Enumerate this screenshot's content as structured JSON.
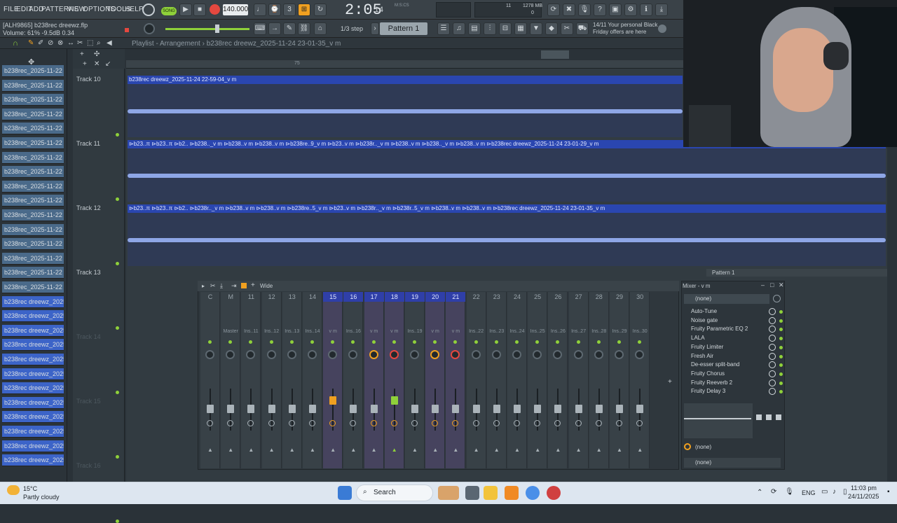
{
  "menu": [
    "FILE",
    "EDIT",
    "ADD",
    "PATTERNS",
    "VIEW",
    "OPTIONS",
    "TOOLS",
    "HELP"
  ],
  "song_badge": "SONG",
  "tempo": "140.000",
  "time": "2:05",
  "time_ms": "14",
  "time_sub": "M:S:CS",
  "cpu_mem": "1278 MB",
  "cpu_voices": "11",
  "cpu_zero": "0",
  "hint": {
    "line1": "[ALH9865] b238rec dreewz.flp",
    "line2": "Volume: 61%  -9.5dB  0.34"
  },
  "snap": "1/3 step",
  "pattern": "Pattern 1",
  "news": {
    "line1": "14/11  Your personal Black",
    "line2": "Friday offers are here"
  },
  "breadcrumb": "Playlist - Arrangement  ›  b238rec dreewz_2025-11-24 23-01-35_v m",
  "ruler_mark": "75",
  "browser": {
    "items": [
      "b238rec_2025-11-22 05-",
      "b238rec_2025-11-22 05-...",
      "b238rec_2025-11-22 05-...",
      "b238rec_2025-11-22 05-...",
      "b238rec_2025-11-22 05-...",
      "b238rec_2025-11-22 05-...",
      "b238rec_2025-11-22 06-...",
      "b238rec_2025-11-22 06-...",
      "b238rec_2025-11-22 06-...",
      "b238rec_2025-11-22 06-...",
      "b238rec_2025-11-22 06-...",
      "b238rec_2025-11-22 06-...",
      "b238rec_2025-11-22 06-...",
      "b238rec_2025-11-22 06-...",
      "b238rec_2025-11-22 06-...",
      "b238rec_2025-11-22 06-...",
      "b238rec dreewz_2025-11...",
      "b238rec dreewz_2025-11...",
      "b238rec dreewz_2025-11...",
      "b238rec dreewz_2025-11...",
      "b238rec dreewz_2025-11...",
      "b238rec dreewz_2025-11...",
      "b238rec dreewz_2025-11...",
      "b238rec dreewz_2025-11...",
      "b238rec dreewz_2025-11...",
      "b238rec dreewz_2025-11...",
      "b238rec dreewz_2025-11...",
      "b238rec dreewz_2025-11..."
    ]
  },
  "tracks": [
    {
      "label": "Track 10",
      "clip": "b238rec dreewz_2025-11-24 22-59-04_v m"
    },
    {
      "label": "Track 11",
      "clip": "⊳b23..π ⊳b23..π ⊳b2..  ⊳b238.._v m ⊳b238..v m ⊳b238..v m ⊳b238re..9_v m ⊳b23..v m ⊳b238r.._v m ⊳b238..v m ⊳b238.._v m ⊳b238..v m ⊳b238rec dreewz_2025-11-24 23-01-29_v m"
    },
    {
      "label": "Track 12",
      "clip": "⊳b23..π ⊳b23..π ⊳b2..  ⊳b238r.._v m ⊳b238..v m ⊳b238..v m ⊳b238re..5_v m ⊳b23..v m ⊳b238r.._v m ⊳b238r..5_v m ⊳b238..v m ⊳b238..v m ⊳b238rec dreewz_2025-11-24 23-01-35_v m"
    },
    {
      "label": "Track 13"
    },
    {
      "label": "Track 14"
    },
    {
      "label": "Track 15"
    },
    {
      "label": "Track 16"
    }
  ],
  "pattern_tag": "Pattern 1",
  "mixer": {
    "view": "Wide",
    "title": "Mixer - v m",
    "channels": [
      "C",
      "M",
      "11",
      "12",
      "13",
      "14",
      "15",
      "16",
      "17",
      "18",
      "19",
      "20",
      "21",
      "22",
      "23",
      "24",
      "25",
      "26",
      "27",
      "28",
      "29",
      "30"
    ],
    "names": [
      "",
      "Master",
      "Ins..11",
      "Ins..12",
      "Ins..13",
      "Ins..14",
      "v m",
      "Ins..16",
      "v m",
      "v m",
      "Ins..19",
      "v m",
      "v m",
      "Ins..22",
      "Ins..23",
      "Ins..24",
      "Ins..25",
      "Ins..26",
      "Ins..27",
      "Ins..28",
      "Ins..29",
      "Ins..30"
    ],
    "input": "(none)",
    "slots": [
      "Auto-Tune",
      "Noise gate",
      "Fruity Parametric EQ 2",
      "LALA",
      "Fruity Limiter",
      "Fresh Air",
      "De-esser split-band",
      "Fruity Chorus",
      "Fruity Reeverb 2",
      "Fruity Delay 3"
    ],
    "send1": "(none)",
    "send2": "(none)"
  },
  "taskbar": {
    "temp": "15°C",
    "weather": "Partly cloudy",
    "search": "Search",
    "lang": "ENG",
    "time": "11:03 pm",
    "date": "24/11/2025"
  },
  "colors": {
    "accent": "#f0a020",
    "clip": "#2a46b0",
    "selected_channel": "#2f3fa8",
    "green": "#8fd13a"
  }
}
